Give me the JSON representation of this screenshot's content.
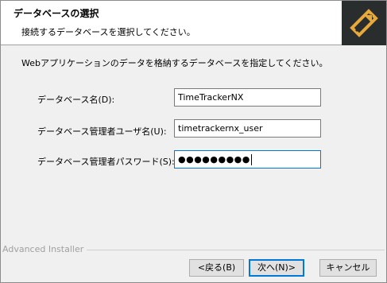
{
  "header": {
    "title": "データベースの選択",
    "subtitle": "接続するデータベースを選択してください。"
  },
  "body": {
    "intro": "Webアプリケーションのデータを格納するデータベースを指定してください。",
    "fields": {
      "db_name": {
        "label": "データベース名(D):",
        "value": "TimeTrackerNX"
      },
      "admin_user": {
        "label": "データベース管理者ユーザ名(U):",
        "value": "timetrackernx_user"
      },
      "admin_password": {
        "label": "データベース管理者パスワード(S):",
        "masked_value": "●●●●●●●●●"
      }
    }
  },
  "footer": {
    "branding": "Advanced Installer",
    "back_label": "<戻る(B)",
    "next_label": "次へ(N)>",
    "cancel_label": "キャンセル"
  },
  "colors": {
    "logo_bg": "#2a2d2e",
    "logo_accent": "#e8a93b",
    "focus_border": "#0078d7"
  }
}
